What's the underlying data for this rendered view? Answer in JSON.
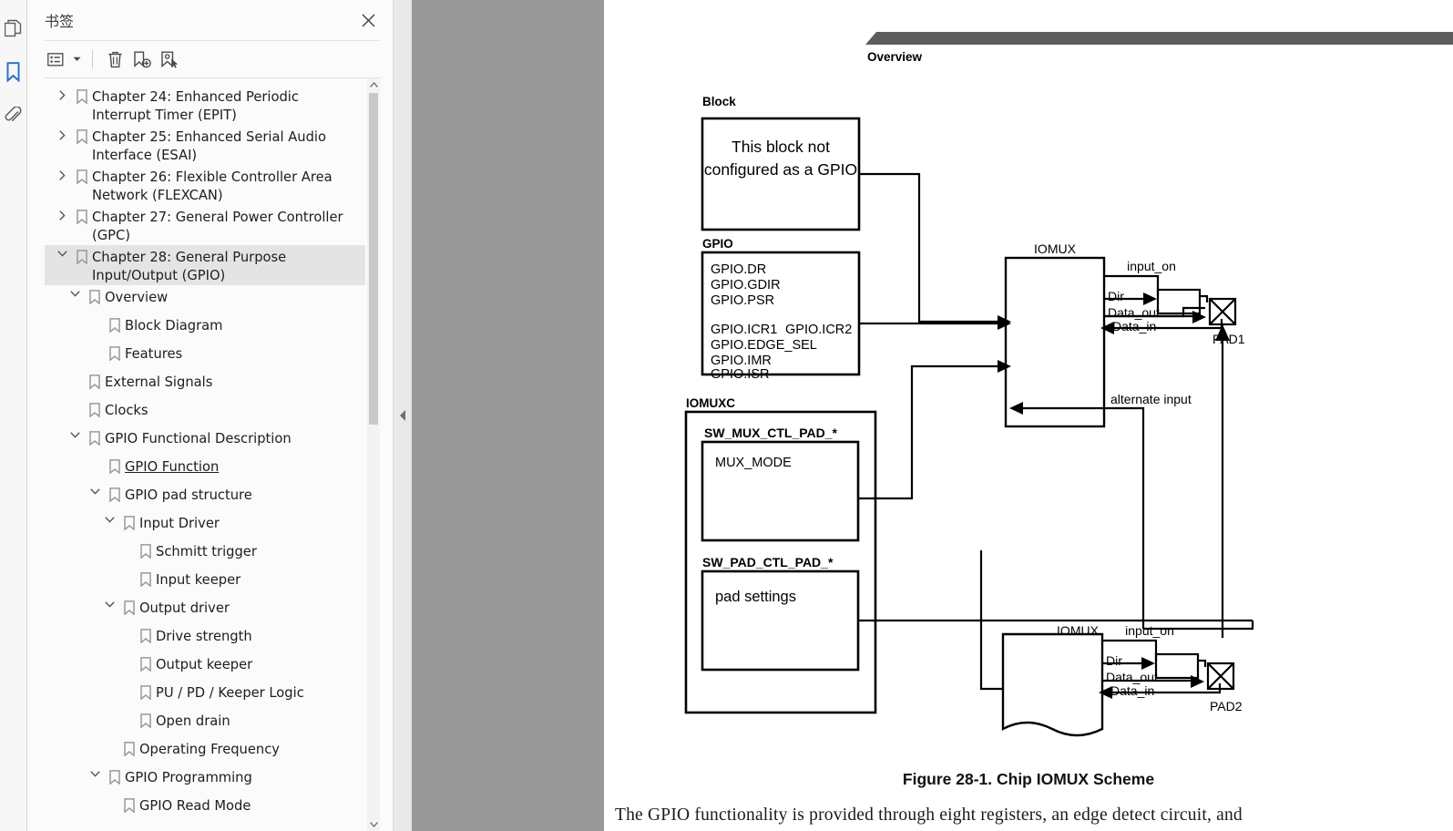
{
  "rail": {
    "items": [
      {
        "name": "pages-icon",
        "label": "Page Thumbnails",
        "active": false
      },
      {
        "name": "bookmark-icon",
        "label": "Bookmarks",
        "active": true
      },
      {
        "name": "attachment-icon",
        "label": "Attachments",
        "active": false
      }
    ],
    "active_color": "#1c6fd0",
    "inactive_color": "#5d5d5d"
  },
  "panel": {
    "title": "书签",
    "close_label": "×",
    "toolbar": [
      {
        "name": "list-options-button",
        "label": "Options"
      },
      {
        "name": "delete-bookmark-button",
        "label": "Delete"
      },
      {
        "name": "new-bookmark-button",
        "label": "New Bookmark"
      },
      {
        "name": "bookmark-select-button",
        "label": "Select Bookmark"
      }
    ]
  },
  "bookmarks": [
    {
      "label": "Chapter 24: Enhanced Periodic Interrupt Timer (EPIT)",
      "depth": 1,
      "twisty": "collapsed",
      "selected": false,
      "hover": false
    },
    {
      "label": "Chapter 25: Enhanced Serial Audio Interface (ESAI)",
      "depth": 1,
      "twisty": "collapsed",
      "selected": false,
      "hover": false
    },
    {
      "label": "Chapter 26: Flexible Controller Area Network (FLEXCAN)",
      "depth": 1,
      "twisty": "collapsed",
      "selected": false,
      "hover": false
    },
    {
      "label": "Chapter 27: General Power Controller (GPC)",
      "depth": 1,
      "twisty": "collapsed",
      "selected": false,
      "hover": false
    },
    {
      "label": "Chapter 28: General Purpose Input/Output (GPIO)",
      "depth": 1,
      "twisty": "expanded",
      "selected": true,
      "hover": false
    },
    {
      "label": "Overview",
      "depth": 2,
      "twisty": "expanded",
      "selected": false,
      "hover": false
    },
    {
      "label": "Block Diagram",
      "depth": 3,
      "twisty": "none",
      "selected": false,
      "hover": false
    },
    {
      "label": "Features",
      "depth": 3,
      "twisty": "none",
      "selected": false,
      "hover": false
    },
    {
      "label": "External Signals",
      "depth": 2,
      "twisty": "none",
      "selected": false,
      "hover": false
    },
    {
      "label": "Clocks",
      "depth": 2,
      "twisty": "none",
      "selected": false,
      "hover": false
    },
    {
      "label": "GPIO Functional Description",
      "depth": 2,
      "twisty": "expanded",
      "selected": false,
      "hover": false
    },
    {
      "label": "GPIO Function",
      "depth": 3,
      "twisty": "none",
      "selected": false,
      "hover": true
    },
    {
      "label": "GPIO pad structure",
      "depth": 3,
      "twisty": "expanded",
      "selected": false,
      "hover": false
    },
    {
      "label": "Input Driver",
      "depth": 4,
      "twisty": "expanded",
      "selected": false,
      "hover": false
    },
    {
      "label": "Schmitt trigger",
      "depth": 5,
      "twisty": "none",
      "selected": false,
      "hover": false
    },
    {
      "label": "Input keeper",
      "depth": 5,
      "twisty": "none",
      "selected": false,
      "hover": false
    },
    {
      "label": "Output driver",
      "depth": 4,
      "twisty": "expanded",
      "selected": false,
      "hover": false
    },
    {
      "label": "Drive strength",
      "depth": 5,
      "twisty": "none",
      "selected": false,
      "hover": false
    },
    {
      "label": "Output keeper",
      "depth": 5,
      "twisty": "none",
      "selected": false,
      "hover": false
    },
    {
      "label": "PU / PD / Keeper Logic",
      "depth": 5,
      "twisty": "none",
      "selected": false,
      "hover": false
    },
    {
      "label": "Open drain",
      "depth": 5,
      "twisty": "none",
      "selected": false,
      "hover": false
    },
    {
      "label": "Operating Frequency",
      "depth": 4,
      "twisty": "none",
      "selected": false,
      "hover": false
    },
    {
      "label": "GPIO Programming",
      "depth": 3,
      "twisty": "expanded",
      "selected": false,
      "hover": false
    },
    {
      "label": "GPIO Read Mode",
      "depth": 4,
      "twisty": "none",
      "selected": false,
      "hover": false
    }
  ],
  "document": {
    "section_title": "Overview",
    "caption": "Figure 28-1. Chip IOMUX Scheme",
    "body_text": "The GPIO functionality is provided through eight registers, an edge detect circuit, and",
    "diagram": {
      "labels": {
        "block": "Block",
        "block_text_line1": "This block not",
        "block_text_line2": "configured as a GPIO",
        "gpio": "GPIO",
        "iomuxc": "IOMUXC",
        "sw_mux_ctl": "SW_MUX_CTL_PAD_*",
        "mux_mode": "MUX_MODE",
        "sw_pad_ctl": "SW_PAD_CTL_PAD_*",
        "pad_settings": "pad settings",
        "iomux_top": "IOMUX",
        "iomux_bottom": "IOMUX",
        "input_on_top": "input_on",
        "input_on_bottom": "input_on",
        "dir_top": "Dir",
        "dir_bottom": "Dir",
        "data_out_top": "Data_out",
        "data_out_bottom": "Data_out",
        "data_in_top": "Data_in",
        "data_in_bottom": "Data_in",
        "alternate_input": "alternate input",
        "pad1": "PAD1",
        "pad2": "PAD2"
      },
      "gpio_registers": [
        "GPIO.DR",
        "GPIO.GDIR",
        "GPIO.PSR",
        "GPIO.ICR1",
        "GPIO.ICR2",
        "GPIO.EDGE_SEL",
        "GPIO.IMR",
        "GPIO.ISR"
      ]
    }
  },
  "colors": {
    "banner": "#5d5d5d",
    "viewer_backdrop": "#999999",
    "selection": "#e4e4e4",
    "accent": "#1c6fd0"
  }
}
